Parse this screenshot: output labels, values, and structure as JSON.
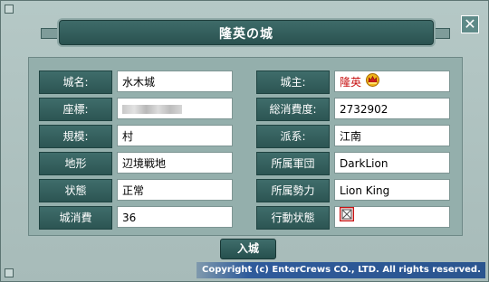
{
  "window": {
    "title": "隆英の城",
    "close_label": "✕"
  },
  "fields_left": [
    {
      "label": "城名:",
      "value": "水木城"
    },
    {
      "label": "座標:",
      "value": ""
    },
    {
      "label": "規模:",
      "value": "村"
    },
    {
      "label": "地形",
      "value": "辺境戦地"
    },
    {
      "label": "状態",
      "value": "正常"
    },
    {
      "label": "城消費",
      "value": "36"
    }
  ],
  "fields_right": [
    {
      "label": "城主:",
      "value": "隆英",
      "value_color": "#c81414",
      "icon": "crown-icon"
    },
    {
      "label": "総消費度:",
      "value": "2732902"
    },
    {
      "label": "派系:",
      "value": "江南"
    },
    {
      "label": "所属軍団",
      "value": "DarkLion"
    },
    {
      "label": "所属勢力",
      "value": "Lion King"
    },
    {
      "label": "行動状態",
      "value": "",
      "icon": "action-status-icon"
    }
  ],
  "enter_button": "入城",
  "copyright": "Copyright (c) EnterCrews CO., LTD. All rights reserved.",
  "colors": {
    "label_bg": "#2c5553",
    "panel_bg": "#94afac",
    "accent_red": "#c81414"
  }
}
